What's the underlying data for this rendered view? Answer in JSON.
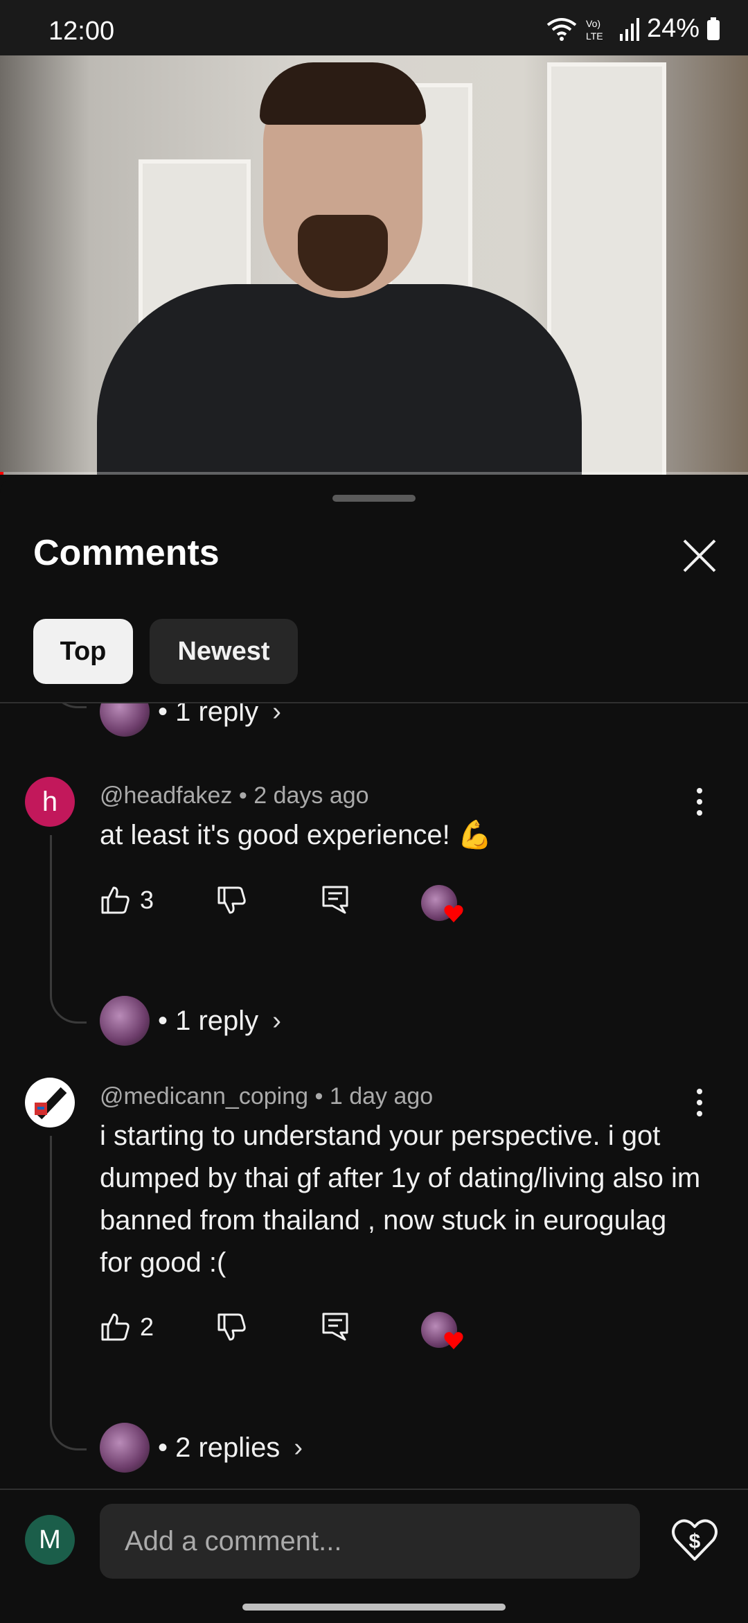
{
  "status_bar": {
    "time": "12:00",
    "battery": "24%",
    "network": "LTE"
  },
  "video": {
    "progress_percent": 0.5
  },
  "comments_panel": {
    "title": "Comments",
    "filters": [
      {
        "label": "Top",
        "selected": true
      },
      {
        "label": "Newest",
        "selected": false
      }
    ],
    "partial_reply_label": "• 1 reply",
    "comments": [
      {
        "avatar_letter": "h",
        "author": "@headfakez",
        "time": "2 days ago",
        "text": "at least it's good experience! 💪",
        "likes": "3",
        "reply_label": "• 1 reply"
      },
      {
        "avatar_letter": "",
        "author": "@medicann_coping",
        "time": "1 day ago",
        "text": "i starting to understand your perspective. i got dumped by thai gf after 1y of dating/living also im banned from thailand , now stuck in eurogulag for good :(",
        "likes": "2",
        "reply_label": "• 2 replies"
      }
    ],
    "separator": "•"
  },
  "composer": {
    "user_initial": "M",
    "placeholder": "Add a comment..."
  },
  "colors": {
    "background": "#0f0f0f",
    "chip_selected": "#f1f1f1",
    "chip_unselected": "#272727",
    "heart": "#ff0000",
    "avatar_h": "#c2185b",
    "avatar_user": "#1b5e4a"
  }
}
